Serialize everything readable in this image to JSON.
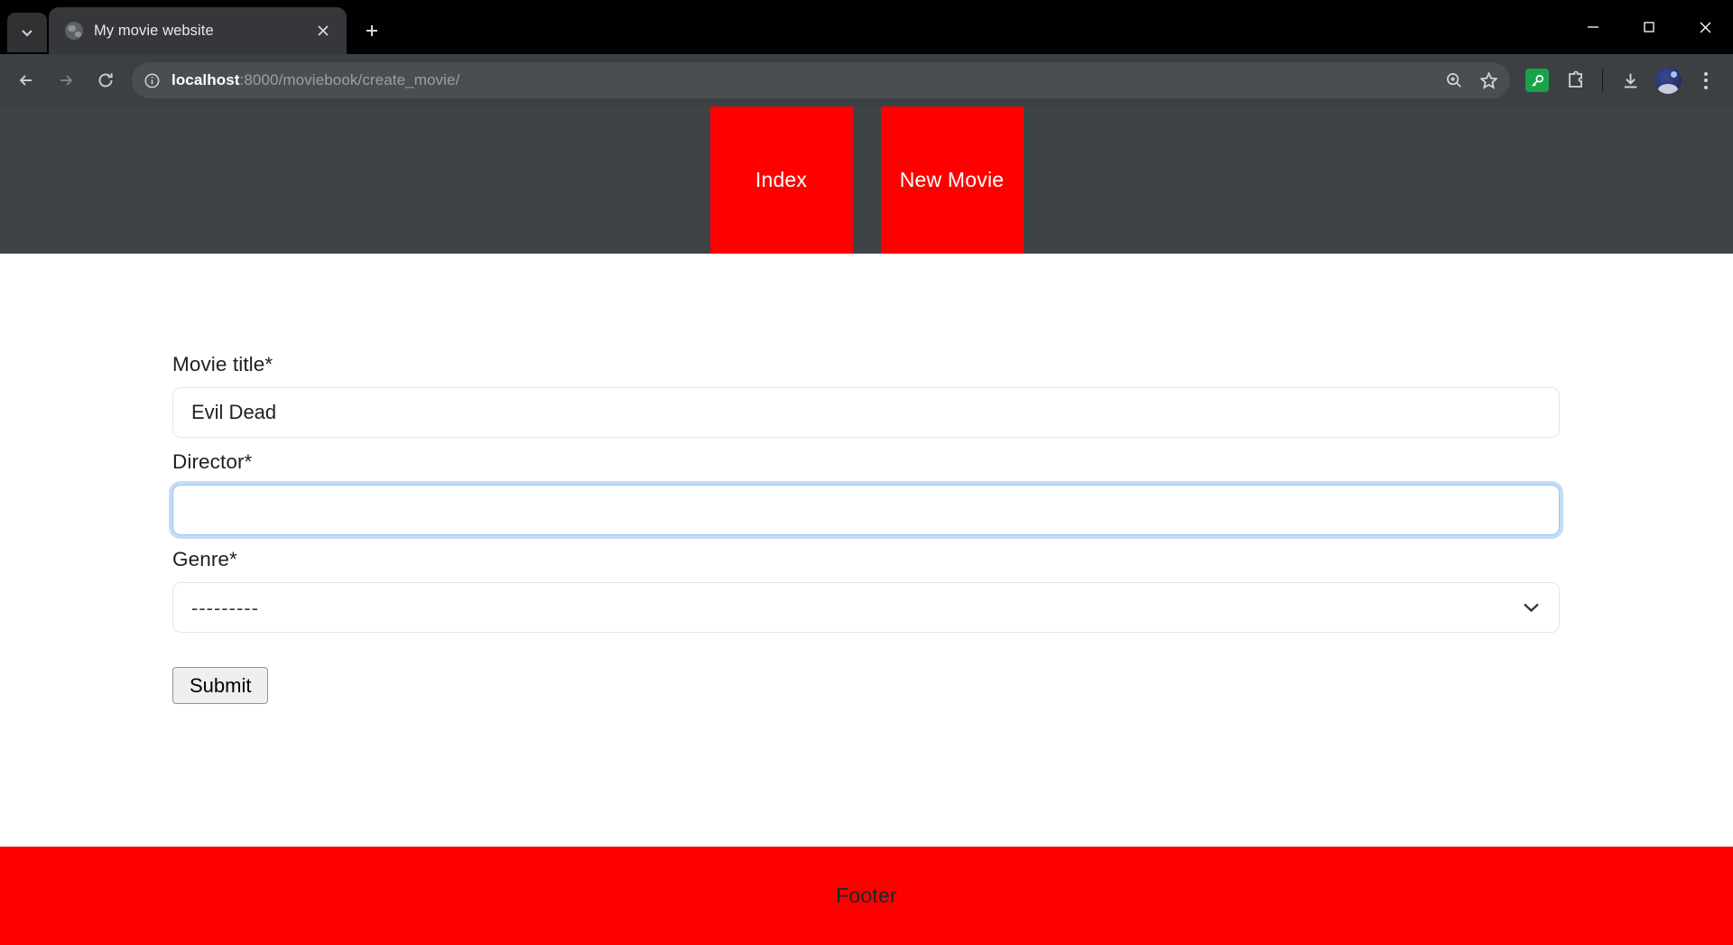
{
  "browser": {
    "tab": {
      "title": "My movie website",
      "favicon": "globe-icon",
      "close_label": "×"
    },
    "tab_search_label": "Search tabs",
    "new_tab_label": "+",
    "window_controls": {
      "minimize": "minimize-icon",
      "maximize": "maximize-icon",
      "close": "close-icon"
    },
    "toolbar": {
      "back": "back-arrow-icon",
      "forward": "forward-arrow-icon",
      "reload": "reload-icon",
      "site_info": "info-circle-icon",
      "url_host": "localhost",
      "url_path": ":8000/moviebook/create_movie/",
      "zoom_icon": "zoom-in-icon",
      "bookmark_icon": "star-icon",
      "password_manager_icon": "key-icon",
      "extensions_icon": "extensions-puzzle-icon",
      "downloads_icon": "download-icon",
      "profile_icon": "avatar-icon",
      "menu_icon": "three-dot-menu-icon"
    }
  },
  "page": {
    "nav": {
      "items": [
        {
          "label": "Index",
          "name": "nav-link-index"
        },
        {
          "label": "New Movie",
          "name": "nav-link-new-movie"
        }
      ],
      "background": "#3e4346",
      "item_background": "#ff0000"
    },
    "form": {
      "fields": [
        {
          "label": "Movie title*",
          "type": "text",
          "value": "Evil Dead",
          "placeholder": "",
          "focused": false
        },
        {
          "label": "Director*",
          "type": "text",
          "value": "",
          "placeholder": "",
          "focused": true
        },
        {
          "label": "Genre*",
          "type": "select",
          "value": "---------",
          "options": [
            "---------"
          ],
          "focused": false
        }
      ],
      "submit_label": "Submit"
    },
    "footer": {
      "text": "Footer",
      "background": "#ff0000"
    }
  }
}
